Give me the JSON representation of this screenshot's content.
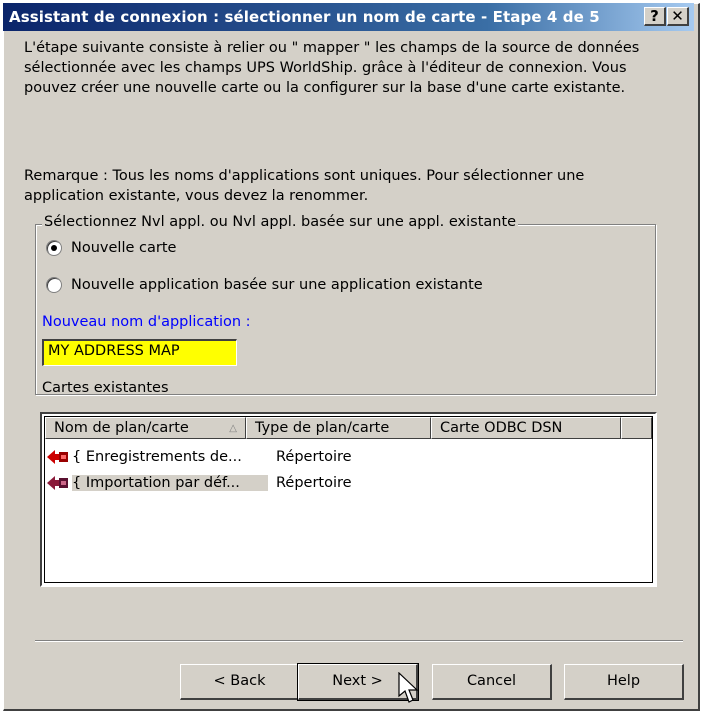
{
  "window": {
    "title": "Assistant de connexion : sélectionner un nom de carte - Etape 4 de 5",
    "help_button": "?",
    "close_button": "✕"
  },
  "intro": {
    "line1": "L'étape suivante consiste à relier ou \" mapper \" les champs de la source de données",
    "line2": "sélectionnée avec les champs UPS WorldShip. grâce à l'éditeur de connexion. Vous",
    "line3": "pouvez créer une nouvelle carte ou la configurer sur la base d'une carte existante."
  },
  "remark": {
    "line1": "Remarque : Tous les noms d'applications sont uniques. Pour sélectionner une",
    "line2": "application existante, vous devez la renommer."
  },
  "group": {
    "legend": "Sélectionnez Nvl appl. ou Nvl appl. basée sur une appl. existante",
    "option_new": "Nouvelle carte",
    "option_based": "Nouvelle application basée sur une application existante",
    "selected": "Nouvelle carte"
  },
  "new_name": {
    "label": "Nouveau nom d'application :",
    "value": "MY ADDRESS MAP"
  },
  "existing_maps": {
    "label": "Cartes existantes",
    "columns": [
      "Nom de plan/carte",
      "Type de plan/carte",
      "Carte ODBC DSN",
      ""
    ],
    "rows": [
      {
        "name": "{ Enregistrements de...",
        "type": "Répertoire"
      },
      {
        "name": "{ Importation par déf...",
        "type": "Répertoire"
      }
    ]
  },
  "buttons": {
    "back": "< Back",
    "next": "Next >",
    "cancel": "Cancel",
    "help": "Help"
  },
  "colors": {
    "title_bar": "#0a246a",
    "dialog_face": "#d4d0c8",
    "input_highlight": "#ffff00",
    "label_blue": "#0000ff",
    "row_icon": "#cc0000"
  },
  "icons": {
    "row_icon": "red-arrow-map-icon",
    "cursor": "mouse-pointer-icon"
  }
}
